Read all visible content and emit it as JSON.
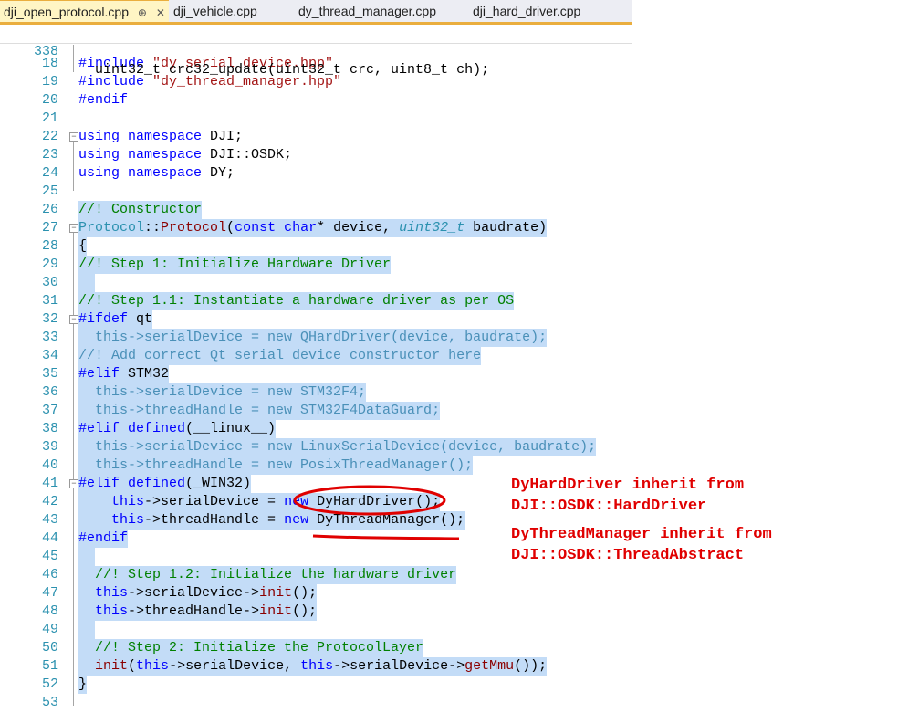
{
  "tabs": [
    {
      "label": "dji_open_protocol.cpp",
      "active": true,
      "pin": "⊕",
      "close": "✕"
    },
    {
      "label": "dji_vehicle.cpp",
      "active": false
    },
    {
      "label": "dy_thread_manager.cpp",
      "active": false
    },
    {
      "label": "dji_hard_driver.cpp",
      "active": false
    }
  ],
  "sticky": {
    "lnum": "338",
    "code": "uint32_t crc32_update(uint32_t crc, uint8_t ch);"
  },
  "lines": [
    {
      "n": "18",
      "code": "#include \"dy_serial_device.hpp\""
    },
    {
      "n": "19",
      "code": "#include \"dy_thread_manager.hpp\""
    },
    {
      "n": "20",
      "code": "#endif"
    },
    {
      "n": "21",
      "code": ""
    },
    {
      "n": "22",
      "code": "using namespace DJI;"
    },
    {
      "n": "23",
      "code": "using namespace DJI::OSDK;"
    },
    {
      "n": "24",
      "code": "using namespace DY;"
    },
    {
      "n": "25",
      "code": ""
    },
    {
      "n": "26",
      "code": "//! Constructor"
    },
    {
      "n": "27",
      "code": "Protocol::Protocol(const char* device, uint32_t baudrate)"
    },
    {
      "n": "28",
      "code": "{"
    },
    {
      "n": "29",
      "code": "//! Step 1: Initialize Hardware Driver"
    },
    {
      "n": "30",
      "code": ""
    },
    {
      "n": "31",
      "code": "//! Step 1.1: Instantiate a hardware driver as per OS"
    },
    {
      "n": "32",
      "code": "#ifdef qt"
    },
    {
      "n": "33",
      "code": "  this->serialDevice = new QHardDriver(device, baudrate);"
    },
    {
      "n": "34",
      "code": "//! Add correct Qt serial device constructor here"
    },
    {
      "n": "35",
      "code": "#elif STM32"
    },
    {
      "n": "36",
      "code": "  this->serialDevice = new STM32F4;"
    },
    {
      "n": "37",
      "code": "  this->threadHandle = new STM32F4DataGuard;"
    },
    {
      "n": "38",
      "code": "#elif defined(__linux__)"
    },
    {
      "n": "39",
      "code": "  this->serialDevice = new LinuxSerialDevice(device, baudrate);"
    },
    {
      "n": "40",
      "code": "  this->threadHandle = new PosixThreadManager();"
    },
    {
      "n": "41",
      "code": "#elif defined(_WIN32)"
    },
    {
      "n": "42",
      "code": "    this->serialDevice = new DyHardDriver();"
    },
    {
      "n": "43",
      "code": "    this->threadHandle = new DyThreadManager();"
    },
    {
      "n": "44",
      "code": "#endif"
    },
    {
      "n": "45",
      "code": ""
    },
    {
      "n": "46",
      "code": "  //! Step 1.2: Initialize the hardware driver"
    },
    {
      "n": "47",
      "code": "  this->serialDevice->init();"
    },
    {
      "n": "48",
      "code": "  this->threadHandle->init();"
    },
    {
      "n": "49",
      "code": ""
    },
    {
      "n": "50",
      "code": "  //! Step 2: Initialize the ProtocolLayer"
    },
    {
      "n": "51",
      "code": "  init(this->serialDevice, this->serialDevice->getMmu());"
    },
    {
      "n": "52",
      "code": "}"
    },
    {
      "n": "53",
      "code": ""
    }
  ],
  "annotations": {
    "a1_line1": "DyHardDriver inherit from",
    "a1_line2": "DJI::OSDK::HardDriver",
    "a2_line1": "DyThreadManager inherit from",
    "a2_line2": "DJI::OSDK::ThreadAbstract"
  },
  "colors": {
    "selection": "#c3dcf7",
    "annotation": "#e00000",
    "line_number": "#2b91af",
    "tab_accent": "#eaae3e"
  }
}
